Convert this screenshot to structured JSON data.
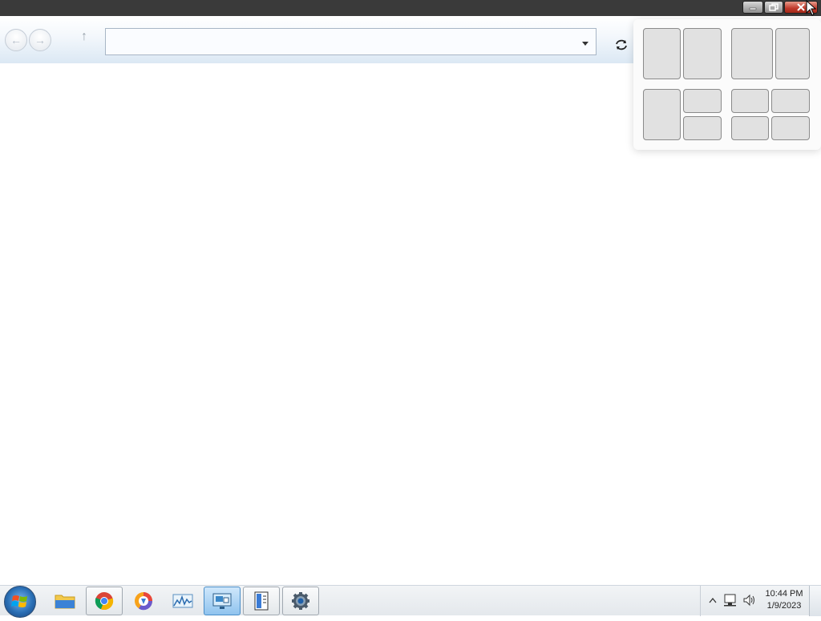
{
  "window": {
    "caption": {
      "minimize_icon": "minimize-icon",
      "restore_icon": "restore-icon",
      "close_icon": "close-icon"
    }
  },
  "navigation": {
    "back_icon": "back-arrow-icon",
    "forward_icon": "forward-arrow-icon",
    "up_icon": "up-arrow-icon",
    "address_value": "",
    "dropdown_icon": "chevron-down-icon",
    "refresh_icon": "refresh-icon"
  },
  "snap_layouts": {
    "layouts": [
      "two-equal-columns",
      "wide-left-narrow-right",
      "one-left-two-right-stacked",
      "four-quadrants"
    ]
  },
  "taskbar": {
    "start_icon": "windows-start-orb-icon",
    "pinned": [
      {
        "icon": "file-explorer-icon",
        "active": false,
        "framed": false
      },
      {
        "icon": "chrome-icon",
        "active": false,
        "framed": true
      },
      {
        "icon": "browser-icon",
        "active": false,
        "framed": false
      },
      {
        "icon": "performance-monitor-icon",
        "active": false,
        "framed": false
      },
      {
        "icon": "remote-desktop-icon",
        "active": true,
        "framed": true
      },
      {
        "icon": "document-viewer-icon",
        "active": false,
        "framed": true
      },
      {
        "icon": "settings-gear-icon",
        "active": false,
        "framed": true
      }
    ],
    "tray": {
      "overflow_icon": "chevron-up-icon",
      "network_icon": "network-icon",
      "volume_icon": "volume-icon",
      "time": "10:44 PM",
      "date": "1/9/2023"
    }
  },
  "colors": {
    "titlebar": "#3a3a3a",
    "close_button": "#c0392b",
    "snap_zone": "#e1e1e1",
    "taskbar_active": "#8fc3ee"
  }
}
